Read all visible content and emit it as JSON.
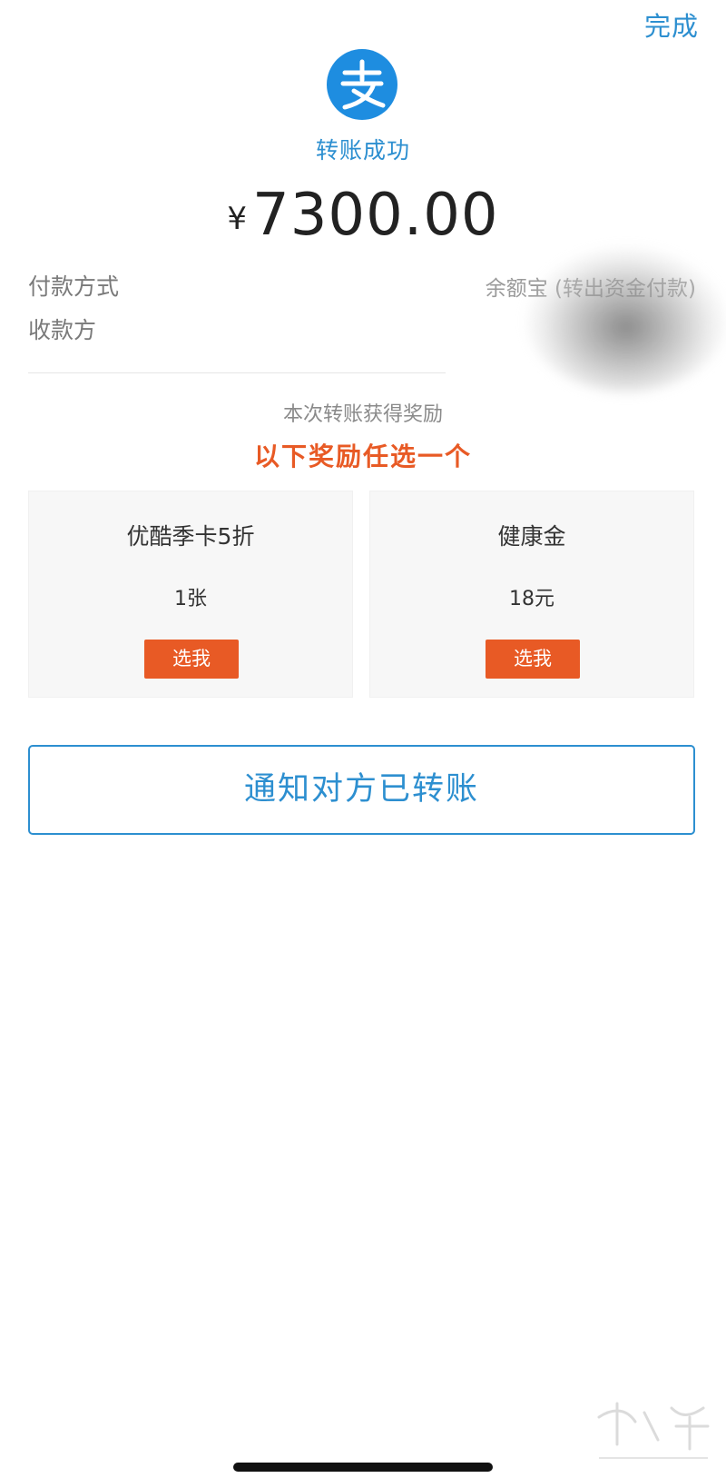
{
  "header": {
    "done_label": "完成"
  },
  "status": {
    "logo_icon": "alipay-logo-icon",
    "title": "转账成功"
  },
  "amount": {
    "currency_symbol": "¥",
    "value": "7300.00"
  },
  "details": {
    "payment_method_label": "付款方式",
    "payment_method_value": "余额宝 (转出资金付款)",
    "payee_label": "收款方"
  },
  "rewards": {
    "subtitle": "本次转账获得奖励",
    "title": "以下奖励任选一个",
    "items": [
      {
        "name": "优酷季卡5折",
        "value": "1张",
        "button_label": "选我"
      },
      {
        "name": "健康金",
        "value": "18元",
        "button_label": "选我"
      }
    ]
  },
  "actions": {
    "notify_label": "通知对方已转账"
  },
  "colors": {
    "accent_blue": "#2d8fd0",
    "reward_orange": "#e85a25"
  }
}
